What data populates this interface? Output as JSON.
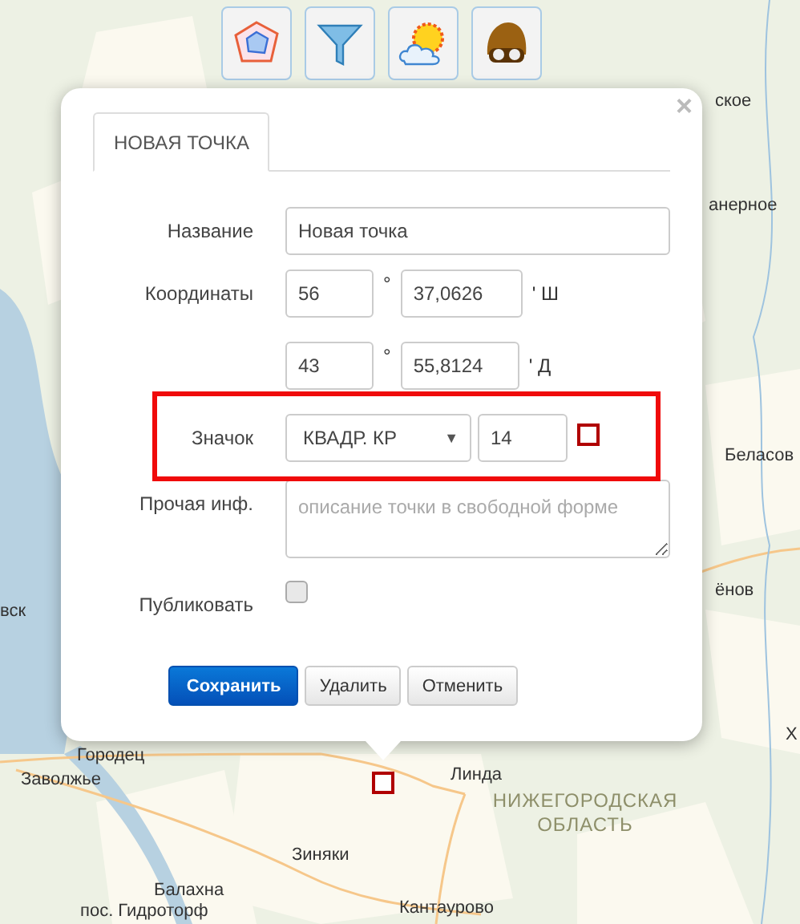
{
  "toolbar": {
    "buttons": [
      {
        "kind": "radar"
      },
      {
        "kind": "filter"
      },
      {
        "kind": "weather"
      },
      {
        "kind": "helmet"
      }
    ]
  },
  "map": {
    "labels": [
      {
        "text": "ское",
        "kind": "town"
      },
      {
        "text": "анерное",
        "kind": "town"
      },
      {
        "text": "Беласов",
        "kind": "town"
      },
      {
        "text": "вск",
        "kind": "town"
      },
      {
        "text": "ёнов",
        "kind": "town"
      },
      {
        "text": "Х",
        "kind": "town"
      },
      {
        "text": "Городец",
        "kind": "town"
      },
      {
        "text": "Заволжье",
        "kind": "town"
      },
      {
        "text": "Линда",
        "kind": "town"
      },
      {
        "text": "НИЖЕГОРОДСКАЯ ОБЛАСТЬ",
        "kind": "region"
      },
      {
        "text": "Зиняки",
        "kind": "town"
      },
      {
        "text": "Балахна",
        "kind": "town"
      },
      {
        "text": "пос. Гидроторф",
        "kind": "town"
      },
      {
        "text": "Кантаурово",
        "kind": "town"
      }
    ]
  },
  "dialog": {
    "close": "×",
    "tabs": [
      {
        "label": "НОВАЯ ТОЧКА",
        "selected": true
      }
    ],
    "name": {
      "label": "Название",
      "value": "Новая точка"
    },
    "coordinates": {
      "label": "Координаты",
      "rows": [
        {
          "degrees": "56",
          "degree_sign": "°",
          "minutes": "37,0626",
          "suffix": "' Ш"
        },
        {
          "degrees": "43",
          "degree_sign": "°",
          "minutes": "55,8124",
          "suffix": "' Д"
        }
      ]
    },
    "icon": {
      "label": "Значок",
      "shape": "КВАДР. КР",
      "dropdown_arrow": "▼",
      "size": "14"
    },
    "info": {
      "label": "Прочая инф.",
      "placeholder": "описание точки в свободной форме"
    },
    "publish": {
      "label": "Публиковать",
      "checked": false
    },
    "buttons": [
      {
        "label": "Сохранить",
        "kind": "primary"
      },
      {
        "label": "Удалить",
        "kind": "default"
      },
      {
        "label": "Отменить",
        "kind": "default"
      }
    ]
  }
}
